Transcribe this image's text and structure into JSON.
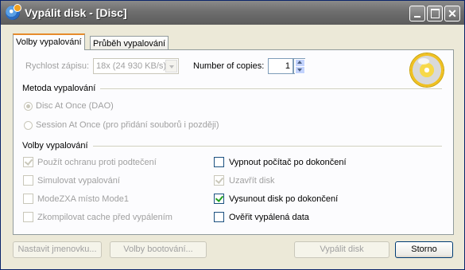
{
  "window": {
    "title": "Vypálit disk - [Disc]"
  },
  "tabs": [
    {
      "label": "Volby vypalování",
      "active": true
    },
    {
      "label": "Průběh vypalování",
      "active": false
    }
  ],
  "speed": {
    "label": "Rychlost zápisu:",
    "value": "18x (24 930 KB/s)"
  },
  "copies": {
    "label": "Number of copies:",
    "value": "1"
  },
  "method": {
    "heading": "Metoda vypalování",
    "options": [
      {
        "label": "Disc At Once (DAO)",
        "selected": true
      },
      {
        "label": "Session At Once (pro přidání souborů i později)",
        "selected": false
      }
    ]
  },
  "options": {
    "heading": "Volby vypalování",
    "left": [
      {
        "label": "Použít ochranu proti podtečení",
        "checked": true,
        "enabled": false
      },
      {
        "label": "Simulovat vypalování",
        "checked": false,
        "enabled": false
      },
      {
        "label": "ModeZXA místo Mode1",
        "checked": false,
        "enabled": false
      },
      {
        "label": "Zkompilovat cache před vypálením",
        "checked": false,
        "enabled": false
      }
    ],
    "right": [
      {
        "label": "Vypnout počítač po dokončení",
        "checked": false,
        "enabled": true
      },
      {
        "label": "Uzavřít disk",
        "checked": true,
        "enabled": false
      },
      {
        "label": "Vysunout disk po dokončení",
        "checked": true,
        "enabled": true
      },
      {
        "label": "Ověřit vypálená data",
        "checked": false,
        "enabled": true
      }
    ]
  },
  "buttons": {
    "set_label": "Nastavit jmenovku...",
    "boot_options": "Volby bootování...",
    "burn": "Vypálit disk",
    "cancel": "Storno"
  }
}
